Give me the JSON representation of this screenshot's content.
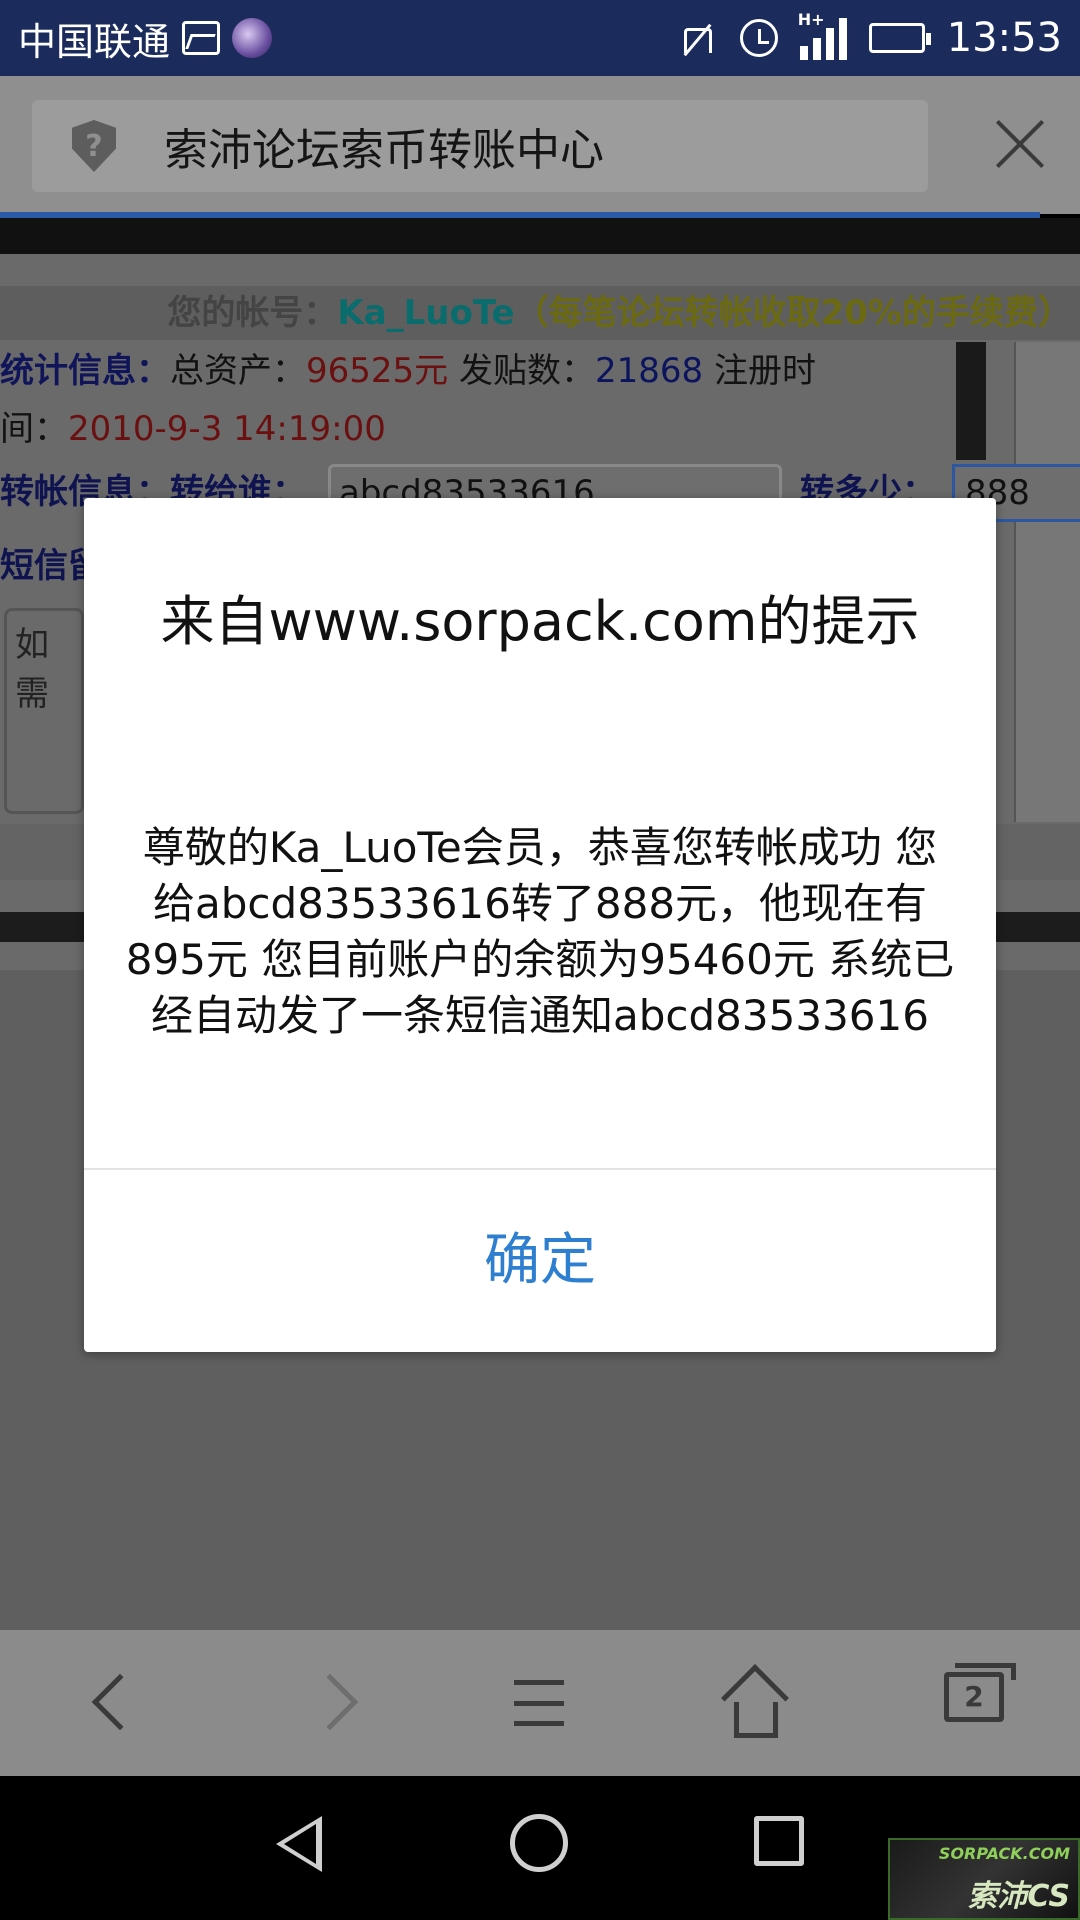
{
  "status_bar": {
    "carrier": "中国联通",
    "signal_label": "H+",
    "time": "13:53"
  },
  "browser": {
    "page_title": "索沛论坛索币转账中心",
    "shield_glyph": "?"
  },
  "page": {
    "account_label": "您的帐号：",
    "account_name": "Ka_LuoTe",
    "fee_note": "（每笔论坛转帐收取20%的手续费）",
    "stats_label": "统计信息：",
    "assets_label": "总资产：",
    "assets_value": "96525元",
    "posts_label": "发贴数：",
    "posts_value": "21868",
    "reg_label": "注册时",
    "reg_label_cont": "间：",
    "reg_value": "2010-9-3 14:19:00",
    "transfer_label": "转帐信息：",
    "to_label": "转给谁：",
    "to_value": "abcd83533616",
    "amount_label": "转多少：",
    "amount_value": "888",
    "sms_label": "短信留",
    "sms_placeholder": "如需"
  },
  "dialog": {
    "title": "来自www.sorpack.com的提示",
    "message": "尊敬的Ka_LuoTe会员，恭喜您转帐成功 您给abcd83533616转了888元，他现在有895元 您目前账户的余额为95460元 系统已经自动发了一条短信通知abcd83533616",
    "ok_label": "确定"
  },
  "toolbar": {
    "tab_count": "2"
  },
  "watermark": {
    "site": "SORPACK.COM",
    "brand": "索沛CS"
  },
  "colors": {
    "status_bar": "#1b2b5b",
    "dialog_button": "#2f7fd1"
  }
}
